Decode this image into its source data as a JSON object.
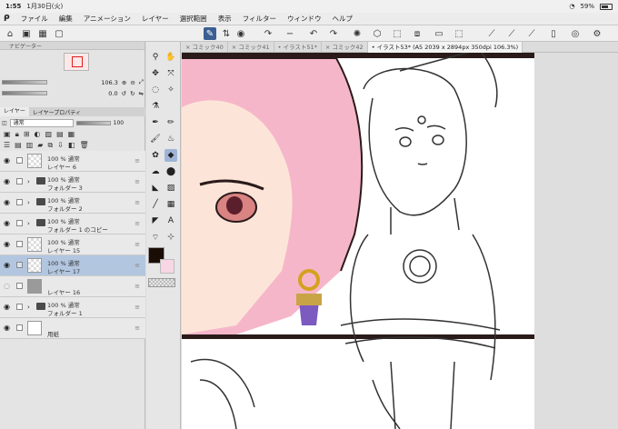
{
  "status": {
    "time": "1:55",
    "date": "1月30日(火)",
    "battery": "59%"
  },
  "menu": [
    "ファイル",
    "編集",
    "アニメーション",
    "レイヤー",
    "選択範囲",
    "表示",
    "フィルター",
    "ウィンドウ",
    "ヘルプ"
  ],
  "navigator": {
    "title": "ナビゲーター",
    "zoom": "106.3",
    "angle": "0.0"
  },
  "layer_tabs": {
    "layer": "レイヤー",
    "property": "レイヤープロパティ"
  },
  "blend": {
    "mode": "通常",
    "opacity": "100"
  },
  "layers": [
    {
      "mode": "100 % 通常",
      "name": "レイヤー 6",
      "type": "raster",
      "selected": false
    },
    {
      "mode": "100 % 通常",
      "name": "フォルダー 3",
      "type": "folder",
      "selected": false
    },
    {
      "mode": "100 % 通常",
      "name": "フォルダー 2",
      "type": "folder",
      "selected": false
    },
    {
      "mode": "100 % 通常",
      "name": "フォルダー 1 のコピー",
      "type": "folder",
      "selected": false
    },
    {
      "mode": "100 % 通常",
      "name": "レイヤー 15",
      "type": "raster",
      "selected": false
    },
    {
      "mode": "100 % 通常",
      "name": "レイヤー 17",
      "type": "raster",
      "selected": true
    },
    {
      "mode": "",
      "name": "レイヤー 16",
      "type": "gray",
      "selected": false
    },
    {
      "mode": "100 % 通常",
      "name": "フォルダー 1",
      "type": "folder",
      "selected": false
    },
    {
      "mode": "",
      "name": "用紙",
      "type": "paper",
      "selected": false
    }
  ],
  "tabs": [
    {
      "label": "コミック40",
      "active": false
    },
    {
      "label": "コミック41",
      "active": false
    },
    {
      "label": "イラスト51*",
      "active": false
    },
    {
      "label": "コミック42",
      "active": false
    },
    {
      "label": "イラスト53* (A5 2039 x 2894px 350dpi 106.3%)",
      "active": true
    }
  ],
  "colors": {
    "main": "#1a0d06",
    "sub": "#f9d6e3",
    "accent": "#3c5f93"
  }
}
